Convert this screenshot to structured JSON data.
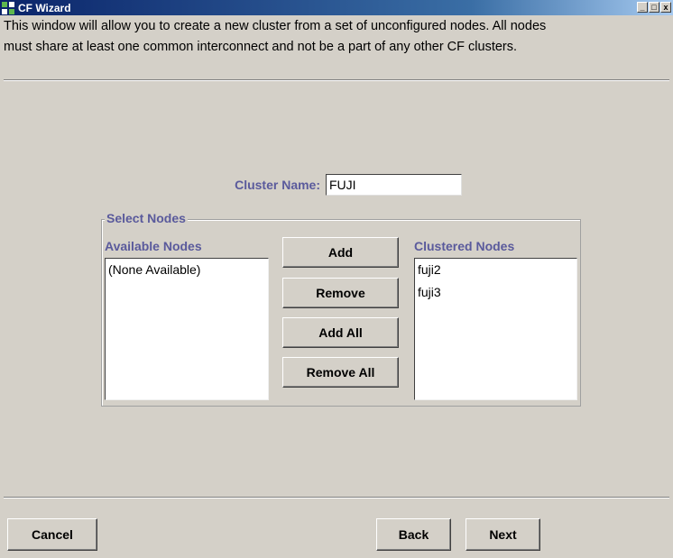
{
  "window": {
    "title": "CF Wizard",
    "controls": [
      "_",
      "□",
      "x"
    ]
  },
  "description": {
    "line1": "This window will allow you to create a new cluster from a set of unconfigured nodes.  All nodes",
    "line2": "must share at least one common interconnect and not be a part of any other CF clusters."
  },
  "form": {
    "cluster_name_label": "Cluster Name:",
    "cluster_name_value": "FUJI"
  },
  "select_nodes": {
    "group_title": "Select Nodes",
    "available_title": "Available Nodes",
    "available_items": [
      "(None Available)"
    ],
    "clustered_title": "Clustered Nodes",
    "clustered_items": [
      "fuji2",
      "fuji3"
    ],
    "buttons": {
      "add": "Add",
      "remove": "Remove",
      "add_all": "Add All",
      "remove_all": "Remove All"
    }
  },
  "footer": {
    "cancel": "Cancel",
    "back": "Back",
    "next": "Next"
  },
  "colors": {
    "background": "#d4d0c8",
    "label_accent": "#5a5a9c",
    "title_bar": "#0a246a"
  }
}
